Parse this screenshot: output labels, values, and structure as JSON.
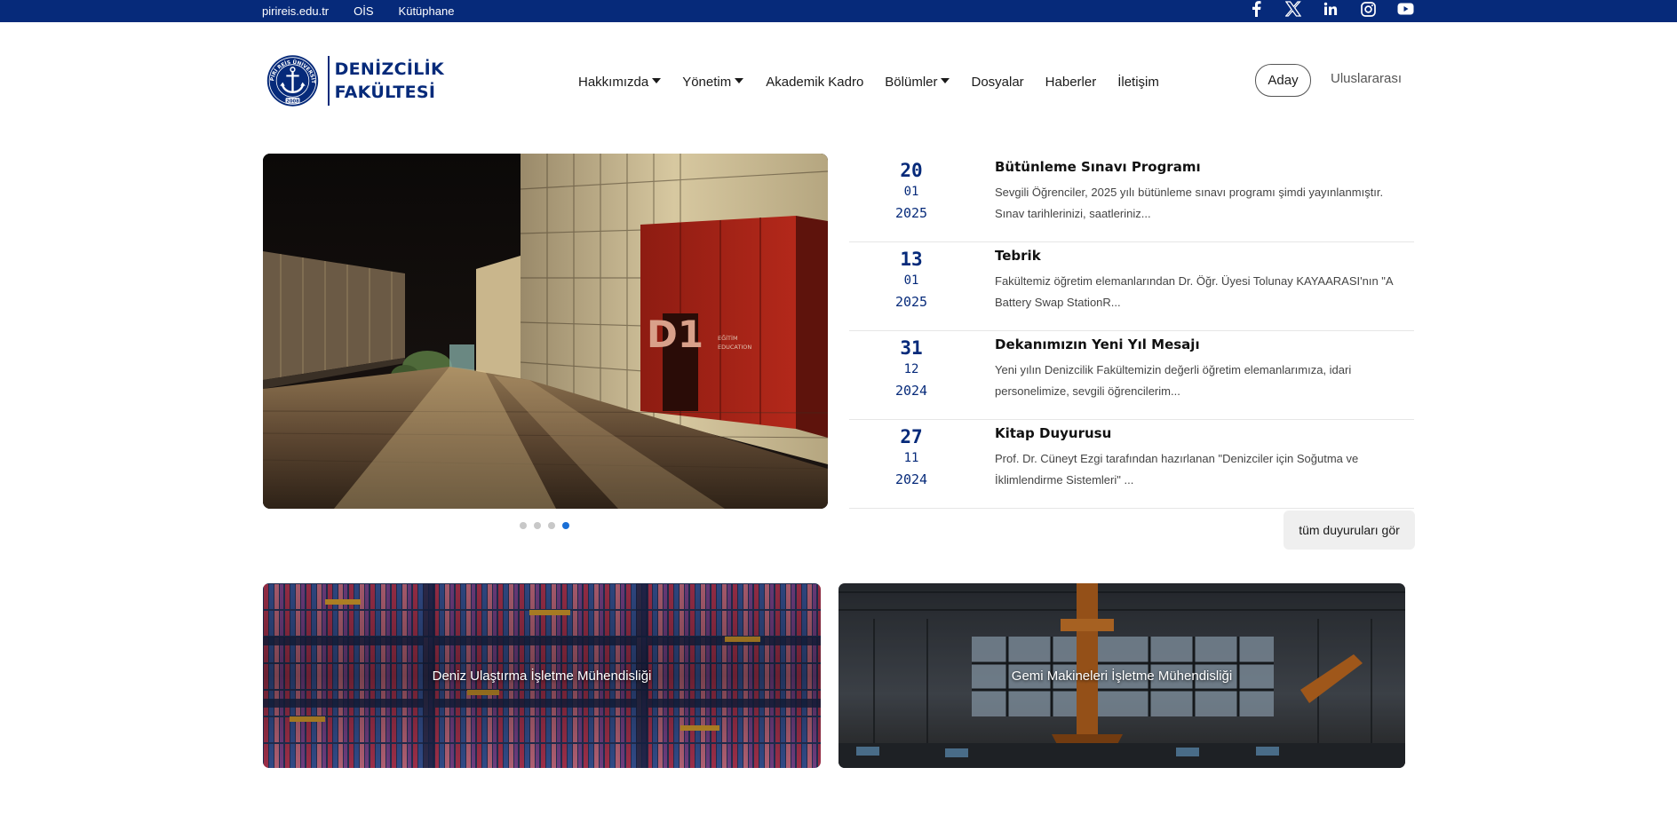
{
  "topbar": {
    "links": [
      "pirireis.edu.tr",
      "OİS",
      "Kütüphane"
    ],
    "social_icons": [
      "facebook-icon",
      "x-icon",
      "linkedin-icon",
      "instagram-icon",
      "youtube-icon"
    ],
    "background": "#062a7a"
  },
  "logo": {
    "line1": "DENİZCİLİK",
    "line2": "FAKÜLTESİ",
    "seal_text": "PİRİ REİS ÜNİVERSİTESİ",
    "seal_year": "2008"
  },
  "nav": {
    "items": [
      {
        "label": "Hakkımızda",
        "dropdown": true
      },
      {
        "label": "Yönetim",
        "dropdown": true
      },
      {
        "label": "Akademik Kadro",
        "dropdown": false
      },
      {
        "label": "Bölümler",
        "dropdown": true
      },
      {
        "label": "Dosyalar",
        "dropdown": false
      },
      {
        "label": "Haberler",
        "dropdown": false
      },
      {
        "label": "İletişim",
        "dropdown": false
      }
    ],
    "aday": "Aday",
    "uluslararasi": "Uluslararası"
  },
  "carousel": {
    "slide_count": 4,
    "active_slide": 4,
    "sign_text": "D1",
    "sign_sub": [
      "EĞİTİM",
      "EDUCATION"
    ]
  },
  "news": [
    {
      "day": "20",
      "month": "01",
      "year": "2025",
      "title": "Bütünleme Sınavı Programı",
      "excerpt_line1": "Sevgili Öğrenciler, 2025 yılı bütünleme sınavı programı şimdi yayınlanmıştır.",
      "excerpt_line2": "Sınav tarihlerinizi, saatleriniz..."
    },
    {
      "day": "13",
      "month": "01",
      "year": "2025",
      "title": "Tebrik",
      "excerpt_line1": "Fakültemiz öğretim elemanlarından Dr. Öğr. Üyesi Tolunay KAYAARASI'nın \"A",
      "excerpt_line2": "Battery Swap StationR..."
    },
    {
      "day": "31",
      "month": "12",
      "year": "2024",
      "title": "Dekanımızın Yeni Yıl Mesajı",
      "excerpt_line1": "Yeni yılın Denizcilik Fakültemizin değerli öğretim elemanlarımıza, idari",
      "excerpt_line2": "personelimize, sevgili öğrencilerim..."
    },
    {
      "day": "27",
      "month": "11",
      "year": "2024",
      "title": "Kitap Duyurusu",
      "excerpt_line1": "Prof. Dr. Cüneyt Ezgi tarafından hazırlanan \"Denizciler için Soğutma ve",
      "excerpt_line2": "İklimlendirme Sistemleri\" ..."
    }
  ],
  "all_news_button": "tüm duyuruları gör",
  "programs": [
    {
      "label": "Deniz Ulaştırma İşletme Mühendisliği"
    },
    {
      "label": "Gemi Makineleri İşletme Mühendisliği"
    }
  ],
  "colors": {
    "brand": "#062a7a",
    "accent_dot": "#1a6fd6"
  }
}
